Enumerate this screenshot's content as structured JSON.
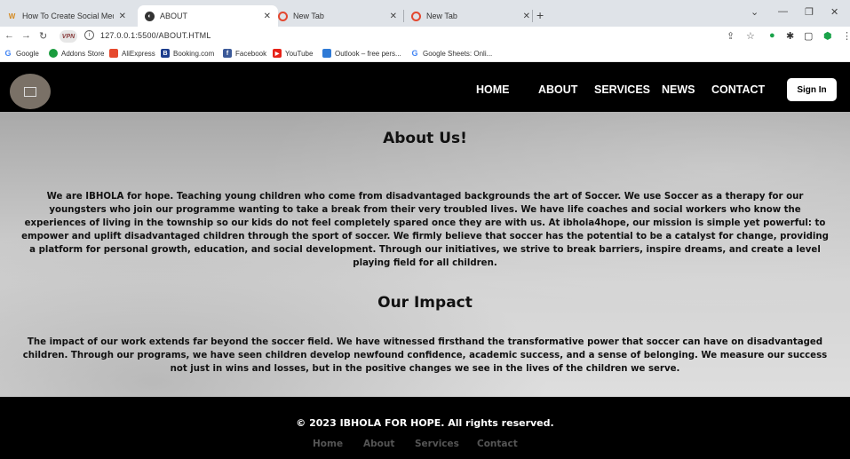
{
  "browser": {
    "tabs": [
      {
        "title": "How To Create Social Media Butt",
        "active": false
      },
      {
        "title": "ABOUT",
        "active": true
      },
      {
        "title": "New Tab",
        "active": false
      },
      {
        "title": "New Tab",
        "active": false
      }
    ],
    "url": "127.0.0.1:5500/ABOUT.HTML",
    "bookmarks": [
      {
        "label": "Google",
        "icon": "google-icon",
        "color": "#4285f4"
      },
      {
        "label": "Addons Store",
        "icon": "opera-icon",
        "color": "#1a9c3e"
      },
      {
        "label": "AliExpress",
        "icon": "aliexpress-icon",
        "color": "#e6492d"
      },
      {
        "label": "Booking.com",
        "icon": "booking-icon",
        "color": "#1b3c8c"
      },
      {
        "label": "Facebook",
        "icon": "facebook-icon",
        "color": "#3b5998"
      },
      {
        "label": "YouTube",
        "icon": "youtube-icon",
        "color": "#e62117"
      },
      {
        "label": "Outlook – free pers...",
        "icon": "outlook-icon",
        "color": "#2f7ad6"
      },
      {
        "label": "Google Sheets: Onli...",
        "icon": "google-icon",
        "color": "#4285f4"
      }
    ]
  },
  "nav": {
    "links": [
      "HOME",
      "ABOUT",
      "SERVICES",
      "NEWS",
      "CONTACT"
    ],
    "signin_label": "Sign In"
  },
  "about": {
    "heading": "About Us!",
    "lines": [
      "We are IBHOLA for hope. Teaching young children who come from disadvantaged backgrounds the art of Soccer. We use Soccer as a therapy for our",
      "youngsters who join our programme wanting to take a break from their very troubled lives. We have life coaches and social workers who know the",
      "experiences of living in the township so our kids do not feel completely spared once they are with us. At ibhola4hope, our mission is simple yet powerful: to",
      "empower and uplift disadvantaged children through the sport of soccer. We firmly believe that soccer has the potential to be a catalyst for change, providing",
      "a platform for personal growth, education, and social development. Through our initiatives, we strive to break barriers, inspire dreams, and create a level",
      "playing field for all children."
    ]
  },
  "impact": {
    "heading": "Our Impact",
    "lines": [
      "The impact of our work extends far beyond the soccer field. We have witnessed firsthand the transformative power that soccer can have on disadvantaged",
      "children. Through our programs, we have seen children develop newfound confidence, academic success, and a sense of belonging. We measure our success",
      "not just in wins and losses, but in the positive changes we see in the lives of the children we serve."
    ]
  },
  "footer": {
    "copyright": "© 2023 IBHOLA FOR HOPE. All rights reserved.",
    "links": [
      "Home",
      "About",
      "Services",
      "Contact"
    ]
  }
}
